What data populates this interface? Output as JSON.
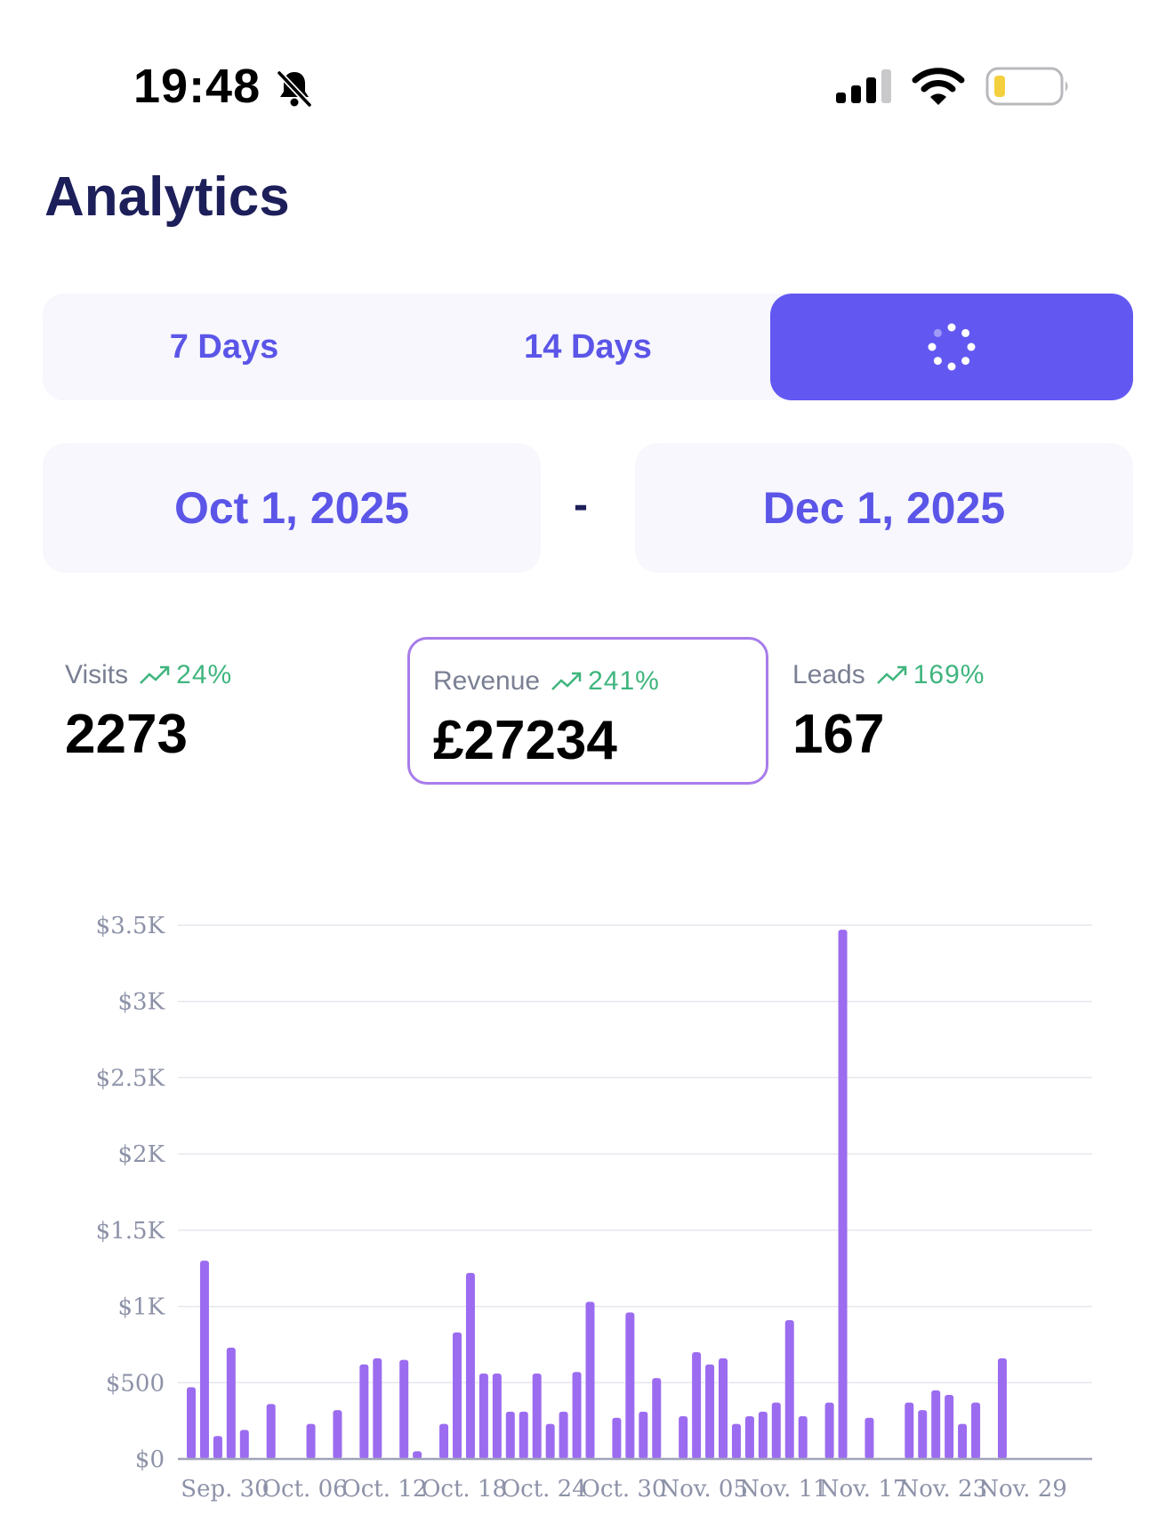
{
  "status_bar": {
    "time": "19:48",
    "icons": [
      "bell-slash-icon",
      "signal-icon",
      "wifi-icon",
      "battery-low-icon"
    ]
  },
  "page": {
    "title": "Analytics"
  },
  "range_selector": {
    "options": [
      "7 Days",
      "14 Days"
    ],
    "active_state": "loading"
  },
  "date_range": {
    "start": "Oct 1, 2025",
    "separator": "-",
    "end": "Dec 1, 2025"
  },
  "metrics": {
    "visits": {
      "label": "Visits",
      "change": "24%",
      "value": "2273"
    },
    "revenue": {
      "label": "Revenue",
      "change": "241%",
      "value": "£27234",
      "selected": true
    },
    "leads": {
      "label": "Leads",
      "change": "169%",
      "value": "167"
    }
  },
  "colors": {
    "accent": "#6258f1",
    "accent_text": "#5b55e8",
    "title": "#1d1f5a",
    "positive": "#3fb57e",
    "bar": "#9b6cf0",
    "selected_border": "#a87cea"
  },
  "chart_data": {
    "type": "bar",
    "y_ticks": [
      "$0",
      "$500",
      "$1K",
      "$1.5K",
      "$2K",
      "$2.5K",
      "$3K",
      "$3.5K"
    ],
    "ylim": [
      0,
      3500
    ],
    "x_ticks": [
      "Sep. 30",
      "Oct. 06",
      "Oct. 12",
      "Oct. 18",
      "Oct. 24",
      "Oct. 30",
      "Nov. 05",
      "Nov. 11",
      "Nov. 17",
      "Nov. 23",
      "Nov. 29"
    ],
    "x": [
      "Sep 30",
      "Oct 1",
      "Oct 2",
      "Oct 3",
      "Oct 4",
      "Oct 5",
      "Oct 6",
      "Oct 7",
      "Oct 8",
      "Oct 9",
      "Oct 10",
      "Oct 11",
      "Oct 12",
      "Oct 13",
      "Oct 14",
      "Oct 15",
      "Oct 16",
      "Oct 17",
      "Oct 18",
      "Oct 19",
      "Oct 20",
      "Oct 21",
      "Oct 22",
      "Oct 23",
      "Oct 24",
      "Oct 25",
      "Oct 26",
      "Oct 27",
      "Oct 28",
      "Oct 29",
      "Oct 30",
      "Oct 31",
      "Nov 1",
      "Nov 2",
      "Nov 3",
      "Nov 4",
      "Nov 5",
      "Nov 6",
      "Nov 7",
      "Nov 8",
      "Nov 9",
      "Nov 10",
      "Nov 11",
      "Nov 12",
      "Nov 13",
      "Nov 14",
      "Nov 15",
      "Nov 16",
      "Nov 17",
      "Nov 18",
      "Nov 19",
      "Nov 20",
      "Nov 21",
      "Nov 22",
      "Nov 23",
      "Nov 24",
      "Nov 25",
      "Nov 26",
      "Nov 27",
      "Nov 28",
      "Nov 29",
      "Nov 30",
      "Dec 1"
    ],
    "values": [
      470,
      1300,
      150,
      730,
      190,
      0,
      360,
      0,
      0,
      230,
      0,
      320,
      0,
      620,
      660,
      0,
      650,
      50,
      0,
      230,
      830,
      1220,
      560,
      560,
      310,
      310,
      560,
      230,
      310,
      570,
      1030,
      0,
      270,
      960,
      310,
      530,
      0,
      280,
      700,
      620,
      660,
      230,
      280,
      310,
      370,
      910,
      280,
      0,
      370,
      3470,
      0,
      270,
      0,
      0,
      370,
      320,
      450,
      420,
      230,
      370,
      0,
      660,
      0
    ],
    "grid": true,
    "legend": false
  }
}
